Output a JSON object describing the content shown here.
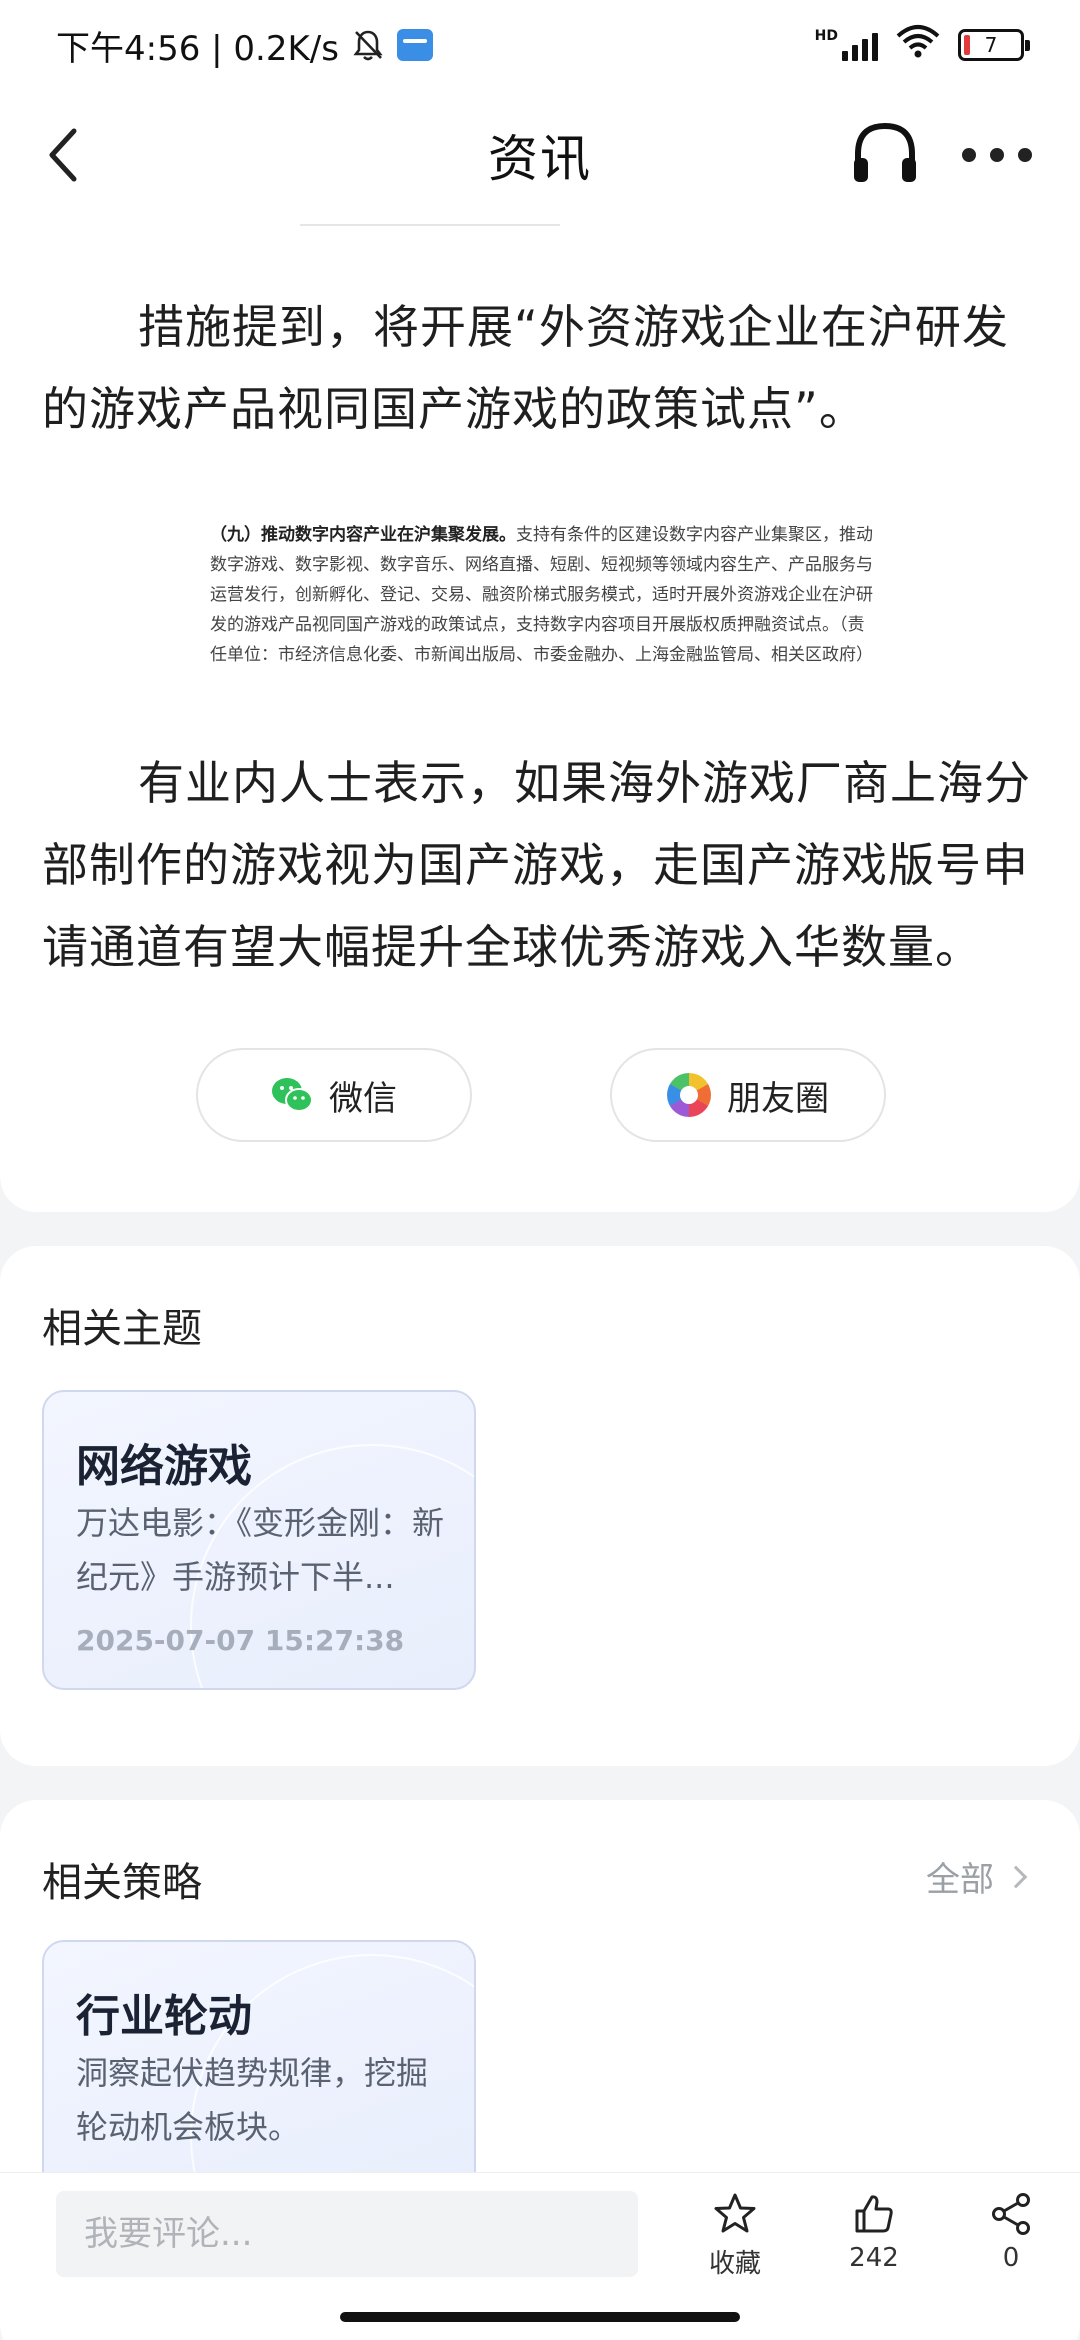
{
  "status_bar": {
    "time_speed": "下午4:56 | 0.2K/s",
    "hd": "HD",
    "battery": "7",
    "icons": [
      "bell-muted-icon",
      "app-notification-icon",
      "signal-icon",
      "wifi-icon",
      "battery-icon"
    ]
  },
  "nav": {
    "title": "资讯",
    "icons": [
      "back-icon",
      "headset-icon",
      "more-icon"
    ]
  },
  "article": {
    "para1": "措施提到，将开展“外资游戏企业在沪研发的游戏产品视同国产游戏的政策试点”。",
    "doc_heading": "（九）推动数字内容产业在沪集聚发展。",
    "doc_body": "支持有条件的区建设数字内容产业集聚区，推动数字游戏、数字影视、数字音乐、网络直播、短剧、短视频等领域内容生产、产品服务与运营发行，创新孵化、登记、交易、融资阶梯式服务模式，适时开展外资游戏企业在沪研发的游戏产品视同国产游戏的政策试点，支持数字内容项目开展版权质押融资试点。（责任单位：市经济信息化委、市新闻出版局、市委金融办、上海金融监管局、相关区政府）",
    "para2": "有业内人士表示，如果海外游戏厂商上海分部制作的游戏视为国产游戏，走国产游戏版号申请通道有望大幅提升全球优秀游戏入华数量。",
    "share_wechat": "微信",
    "share_moments": "朋友圈"
  },
  "related_topics": {
    "title": "相关主题",
    "items": [
      {
        "title": "网络游戏",
        "desc": "万达电影：《变形金刚：新纪元》手游预计下半...",
        "time": "2025-07-07 15:27:38"
      }
    ]
  },
  "related_strategies": {
    "title": "相关策略",
    "see_all": "全部",
    "items": [
      {
        "title": "行业轮动",
        "desc": "洞察起伏趋势规律，挖掘轮动机会板块。"
      }
    ]
  },
  "bottom_bar": {
    "comment_placeholder": "我要评论...",
    "favorite_label": "收藏",
    "like_count": "242",
    "share_count": "0"
  },
  "colors": {
    "accent_wechat": "#2fc15a",
    "battery_low": "#e23b3b",
    "tile_border": "#cfd8ee"
  }
}
